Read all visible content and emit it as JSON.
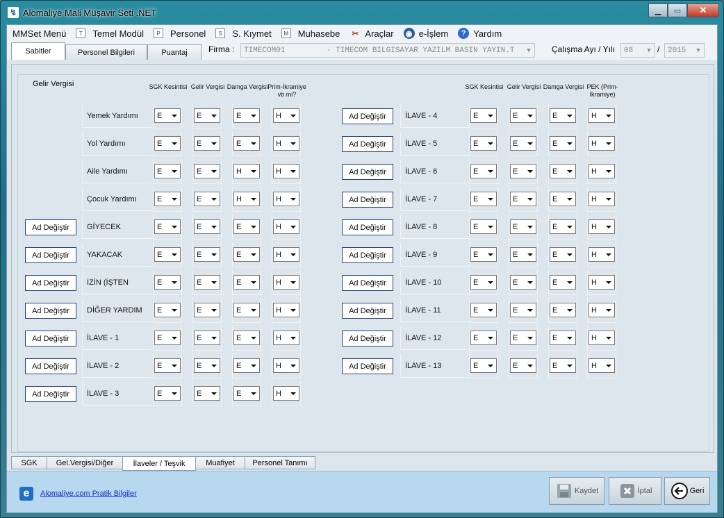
{
  "window": {
    "title": "Alomaliye Mali Müşavir Seti .NET"
  },
  "menu": [
    "MMSet Menü",
    "Temel Modül",
    "Personel",
    "S. Kıymet",
    "Muhasebe",
    "Araçlar",
    "e-İşlem",
    "Yardım"
  ],
  "menu_icon_letters": {
    "temel": "T",
    "personel": "P",
    "skiymet": "S",
    "muhasebe": "M"
  },
  "top_tabs": [
    "Sabitler",
    "Personel Bilgileri",
    "Puantaj"
  ],
  "firma": {
    "label": "Firma :",
    "value": "TIMECOM01         - TİMECOM BİLGİSAYAR YAZILM BASIN YAYIN.T"
  },
  "calisma": {
    "label": "Çalışma Ayı / Yılı",
    "month": "08",
    "separator": "/",
    "year": "2015"
  },
  "group_title": "Gelir Vergisi",
  "left_headers": [
    "SGK Kesintisi",
    "Gelir Vergisi",
    "Damga Vergisi",
    "Prim-İkramiye vb mi?"
  ],
  "right_headers": [
    "SGK Kesintisi",
    "Gelir Vergisi",
    "Damga Vergisi",
    "PEK (Prim-İkramiye)"
  ],
  "ad_button_label": "Ad Değiştir",
  "left_rows": [
    {
      "label": "Yemek Yardımı",
      "ad_button": false,
      "values": [
        "E",
        "E",
        "E",
        "H"
      ]
    },
    {
      "label": "Yol Yardımı",
      "ad_button": false,
      "values": [
        "E",
        "E",
        "E",
        "H"
      ]
    },
    {
      "label": "Aile Yardımı",
      "ad_button": false,
      "values": [
        "E",
        "E",
        "H",
        "H"
      ]
    },
    {
      "label": "Çocuk Yardımı",
      "ad_button": false,
      "values": [
        "E",
        "E",
        "H",
        "H"
      ]
    },
    {
      "label": "GİYECEK",
      "ad_button": true,
      "values": [
        "E",
        "E",
        "E",
        "H"
      ]
    },
    {
      "label": "YAKACAK",
      "ad_button": true,
      "values": [
        "E",
        "E",
        "E",
        "H"
      ]
    },
    {
      "label": "İZİN (İŞTEN",
      "ad_button": true,
      "values": [
        "E",
        "E",
        "E",
        "H"
      ]
    },
    {
      "label": "DİĞER YARDIM",
      "ad_button": true,
      "values": [
        "E",
        "E",
        "E",
        "H"
      ]
    },
    {
      "label": "İLAVE - 1",
      "ad_button": true,
      "values": [
        "E",
        "E",
        "E",
        "H"
      ]
    },
    {
      "label": "İLAVE - 2",
      "ad_button": true,
      "values": [
        "E",
        "E",
        "E",
        "H"
      ]
    },
    {
      "label": "İLAVE - 3",
      "ad_button": true,
      "values": [
        "E",
        "E",
        "E",
        "H"
      ]
    }
  ],
  "right_rows": [
    {
      "label": "İLAVE - 4",
      "values": [
        "E",
        "E",
        "E",
        "H"
      ]
    },
    {
      "label": "İLAVE - 5",
      "values": [
        "E",
        "E",
        "E",
        "H"
      ]
    },
    {
      "label": "İLAVE - 6",
      "values": [
        "E",
        "E",
        "E",
        "H"
      ]
    },
    {
      "label": "İLAVE - 7",
      "values": [
        "E",
        "E",
        "E",
        "H"
      ]
    },
    {
      "label": "İLAVE - 8",
      "values": [
        "E",
        "E",
        "E",
        "H"
      ]
    },
    {
      "label": "İLAVE - 9",
      "values": [
        "E",
        "E",
        "E",
        "H"
      ]
    },
    {
      "label": "İLAVE - 10",
      "values": [
        "E",
        "E",
        "E",
        "H"
      ]
    },
    {
      "label": "İLAVE - 11",
      "values": [
        "E",
        "E",
        "E",
        "H"
      ]
    },
    {
      "label": "İLAVE - 12",
      "values": [
        "E",
        "E",
        "E",
        "H"
      ]
    },
    {
      "label": "İLAVE - 13",
      "values": [
        "E",
        "E",
        "E",
        "H"
      ]
    }
  ],
  "bottom_tabs": [
    "SGK",
    "Gel.Vergisi/Diğer",
    "İlaveler / Teşvik",
    "Muafiyet",
    "Personel Tanımı"
  ],
  "bottom_active": 2,
  "footer": {
    "link": "Alomaliye.com Pratik Bilgiler",
    "kaydet": "Kaydet",
    "iptal": "İptal",
    "geri": "Geri"
  },
  "colors": {
    "accent": "#26407a",
    "footer_bg": "#b8d8f0",
    "panel_bg": "#dde6ec"
  }
}
